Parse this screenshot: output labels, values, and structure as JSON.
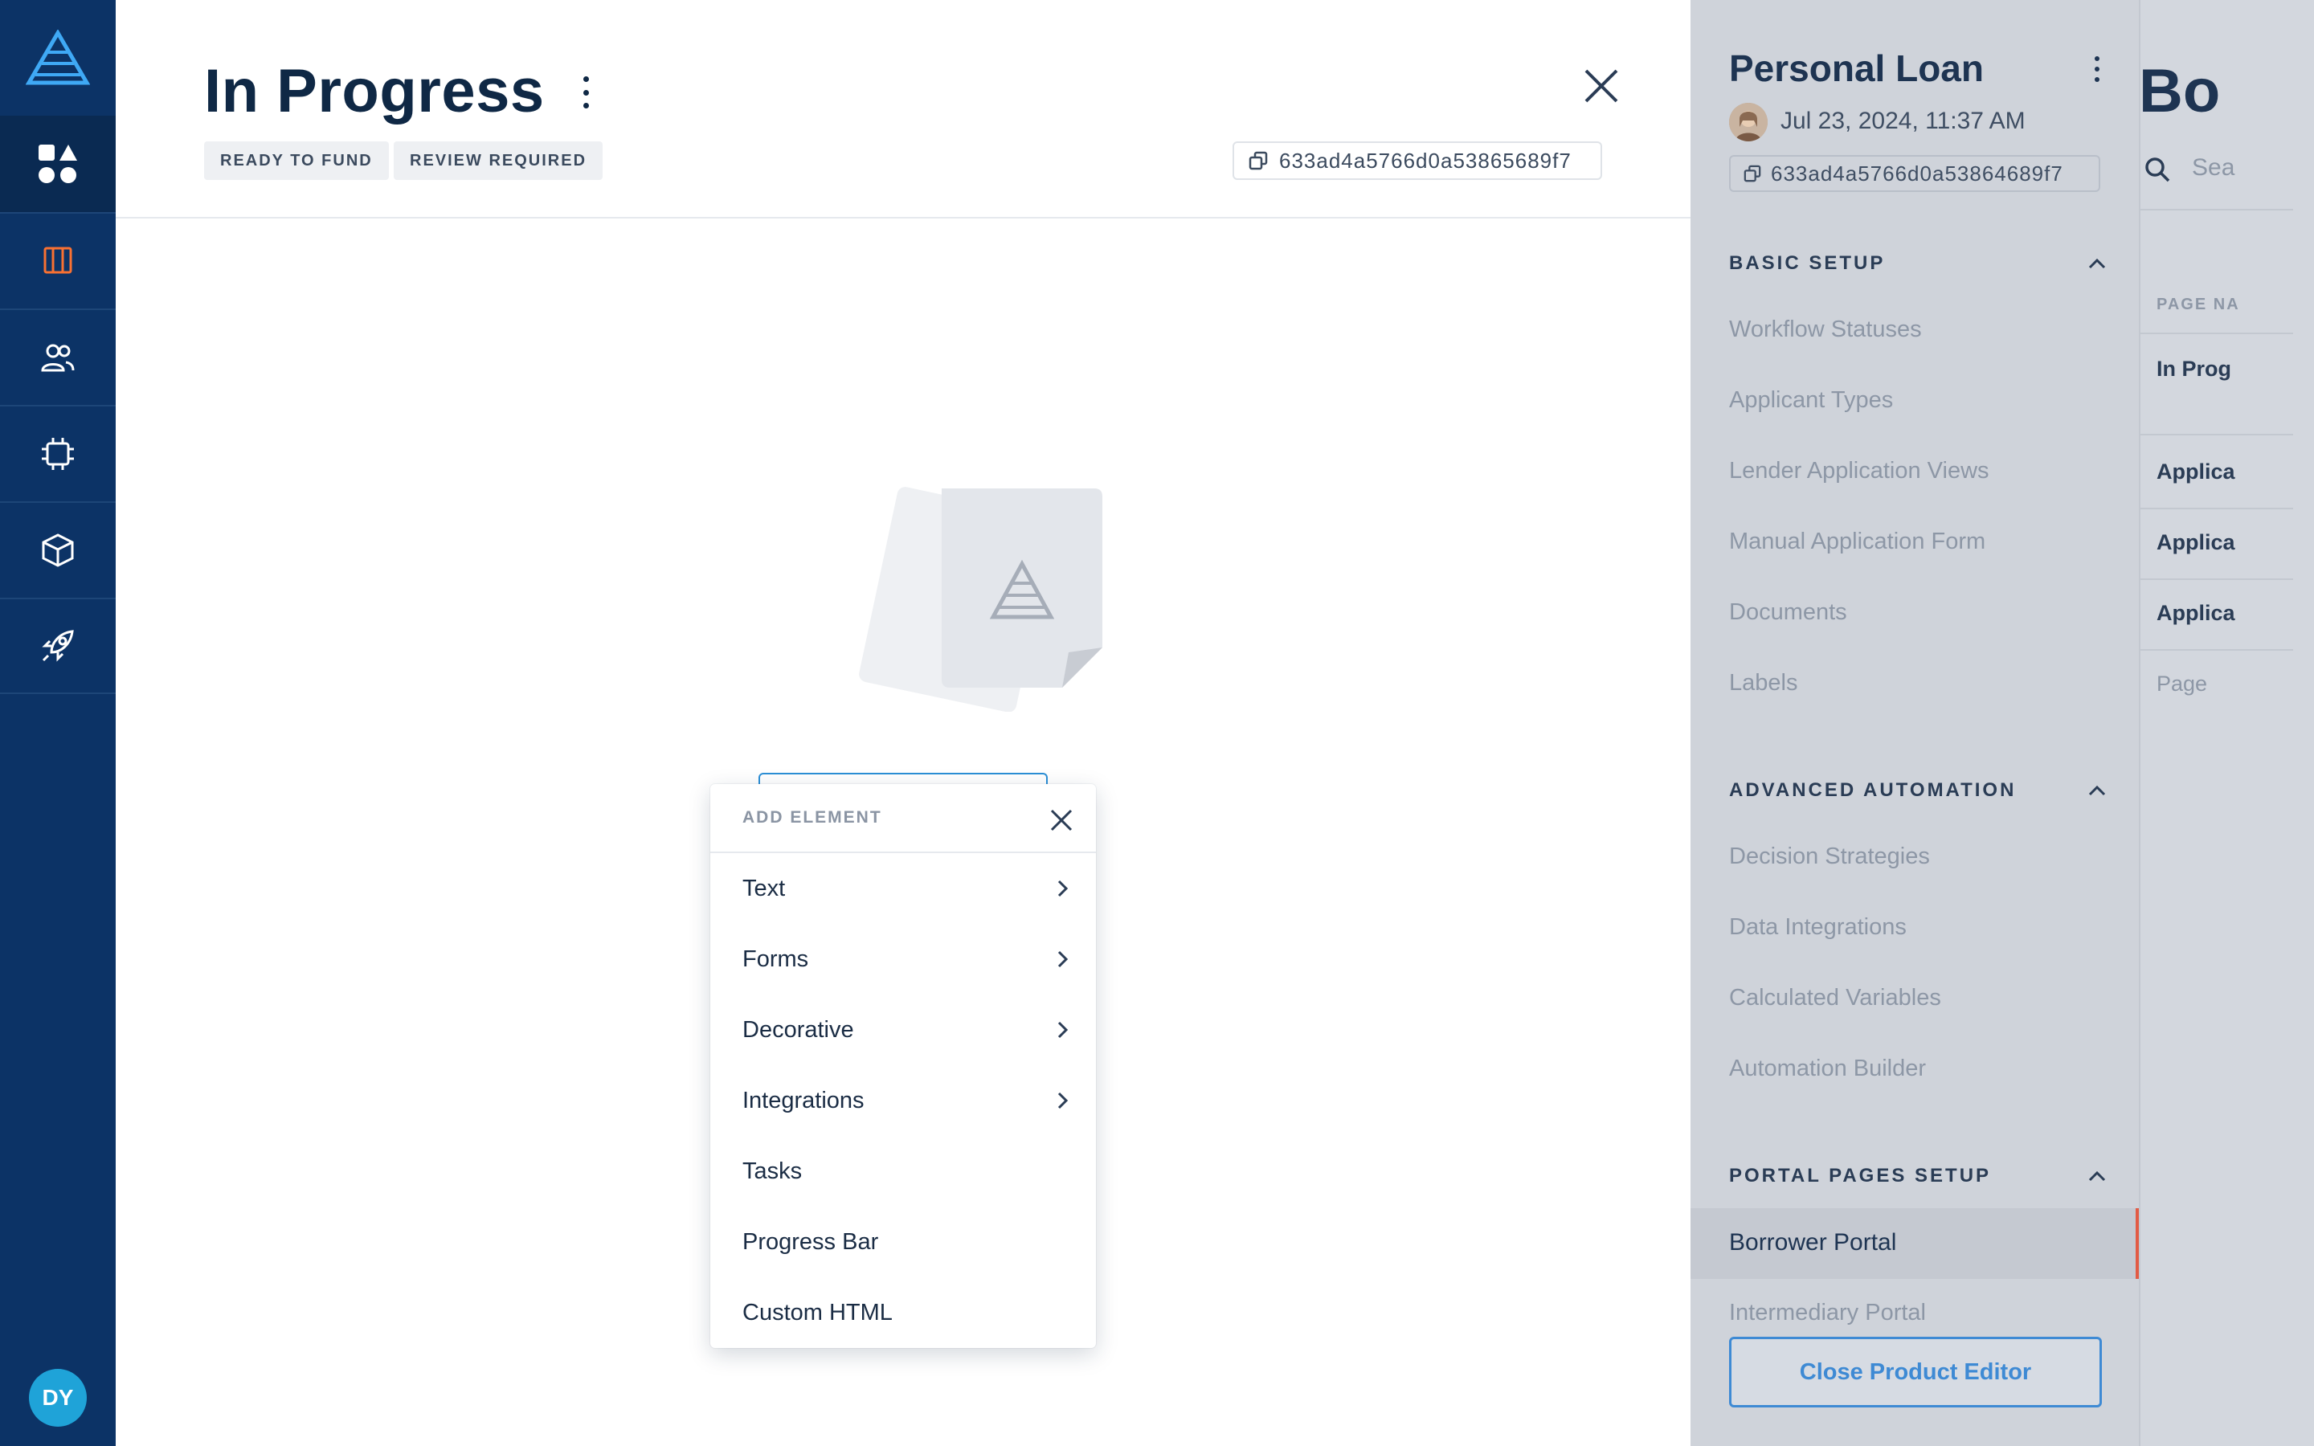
{
  "nav": {
    "avatar_initials": "DY",
    "items": [
      "logo-icon",
      "apps-icon",
      "book-icon",
      "users-icon",
      "chip-icon",
      "box-icon",
      "rocket-icon"
    ],
    "accent": "#f97132"
  },
  "header": {
    "title": "In Progress",
    "badges": [
      "READY TO FUND",
      "REVIEW REQUIRED"
    ],
    "id": "633ad4a5766d0a53865689f7"
  },
  "dropdown": {
    "title": "ADD ELEMENT",
    "items": [
      {
        "label": "Text",
        "has_submenu": true
      },
      {
        "label": "Forms",
        "has_submenu": true
      },
      {
        "label": "Decorative",
        "has_submenu": true
      },
      {
        "label": "Integrations",
        "has_submenu": true
      },
      {
        "label": "Tasks",
        "has_submenu": false
      },
      {
        "label": "Progress Bar",
        "has_submenu": false
      },
      {
        "label": "Custom HTML",
        "has_submenu": false
      }
    ]
  },
  "product_panel": {
    "title": "Personal Loan",
    "date": "Jul 23, 2024, 11:37 AM",
    "id": "633ad4a5766d0a53864689f7",
    "sections": [
      {
        "title": "BASIC SETUP",
        "links": [
          "Workflow Statuses",
          "Applicant Types",
          "Lender Application Views",
          "Manual Application Form",
          "Documents",
          "Labels"
        ]
      },
      {
        "title": "ADVANCED AUTOMATION",
        "links": [
          "Decision Strategies",
          "Data Integrations",
          "Calculated Variables",
          "Automation Builder"
        ]
      },
      {
        "title": "PORTAL PAGES SETUP",
        "links": [
          "Borrower Portal",
          "Intermediary Portal"
        ]
      }
    ],
    "active_link": "Borrower Portal",
    "close_button": "Close Product Editor"
  },
  "right_page": {
    "title": "Bo",
    "search_placeholder": "Sea",
    "column_header": "PAGE NA",
    "rows": [
      "In Prog",
      "Applica",
      "Applica",
      "Applica"
    ],
    "footer_cell": "Page"
  }
}
